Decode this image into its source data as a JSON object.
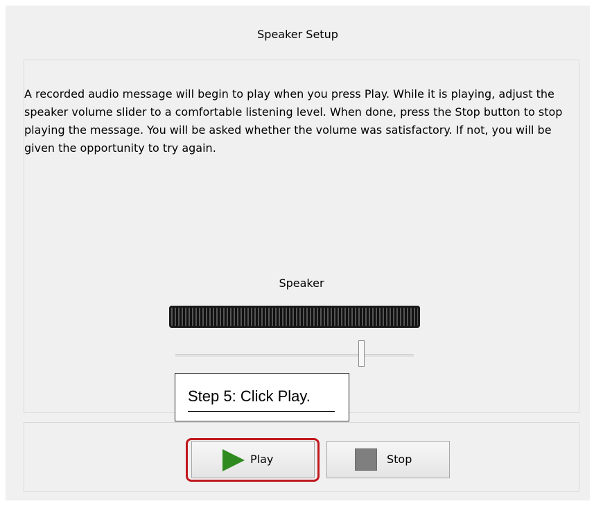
{
  "dialog": {
    "title": "Speaker Setup",
    "instructions": "A recorded audio message will begin to play when you press Play. While it is playing, adjust the speaker volume slider to a comfortable listening level. When done, press the Stop button to stop playing the message. You will be asked whether the volume was satisfactory. If not, you will be given the opportunity to try again."
  },
  "speaker": {
    "label": "Speaker",
    "volume_level": 0.78
  },
  "callout": {
    "text": "Step 5: Click Play."
  },
  "buttons": {
    "play_label": "Play",
    "stop_label": "Stop"
  },
  "colors": {
    "highlight": "#c0171d",
    "play_icon": "#2f8a1f",
    "stop_icon": "#7f7f7f"
  },
  "icons": {
    "play": "play-icon",
    "stop": "stop-icon"
  }
}
